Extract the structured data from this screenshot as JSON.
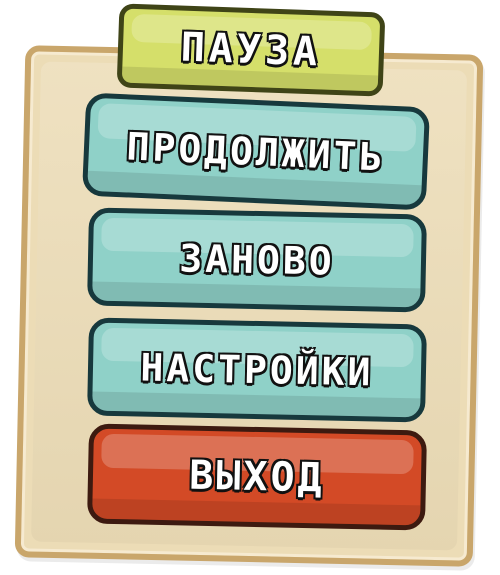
{
  "menu": {
    "title": "ПАУЗА",
    "buttons": {
      "continue": "ПРОДОЛЖИТЬ",
      "restart": "ЗАНОВО",
      "settings": "НАСТРОЙКИ",
      "exit": "ВЫХОД"
    }
  },
  "colors": {
    "panel": "#ecdcb6",
    "panel_border": "#c9a66b",
    "title_bg": "#d5df6a",
    "button_bg": "#8fd1c8",
    "exit_bg": "#d34a26",
    "outline": "#18383c",
    "text": "#ffffff"
  }
}
